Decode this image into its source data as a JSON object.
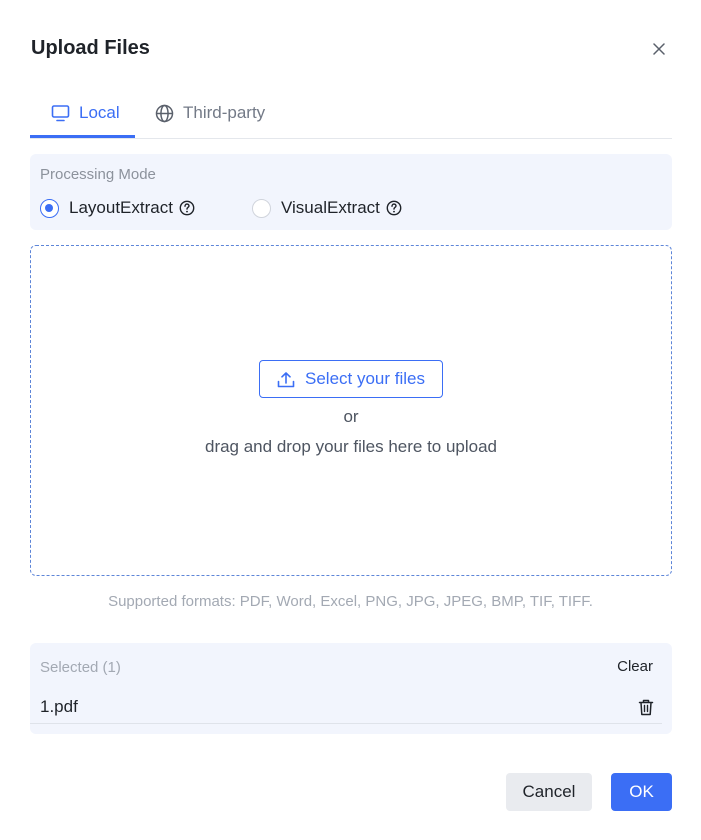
{
  "dialog": {
    "title": "Upload Files",
    "close_icon": "close-icon"
  },
  "tabs": [
    {
      "label": "Local",
      "icon": "monitor-icon",
      "active": true
    },
    {
      "label": "Third-party",
      "icon": "globe-icon",
      "active": false
    }
  ],
  "processing_mode": {
    "label": "Processing Mode",
    "options": [
      {
        "label": "LayoutExtract",
        "checked": true,
        "icon": "help-icon"
      },
      {
        "label": "VisualExtract",
        "checked": false,
        "icon": "help-icon"
      }
    ]
  },
  "dropzone": {
    "button_label": "Select your files",
    "button_icon": "upload-icon",
    "or_text": "or",
    "drag_text": "drag and drop your files here to upload"
  },
  "formats_text": "Supported formats: PDF, Word, Excel, PNG, JPG, JPEG, BMP, TIF, TIFF.",
  "selected": {
    "label": "Selected (1)",
    "clear_label": "Clear",
    "files": [
      {
        "name": "1.pdf",
        "icon": "trash-icon"
      }
    ]
  },
  "footer": {
    "cancel_label": "Cancel",
    "ok_label": "OK"
  },
  "colors": {
    "accent": "#3b6ef5",
    "panel_bg": "#f2f5fd",
    "muted_text": "#a3a9b3"
  }
}
